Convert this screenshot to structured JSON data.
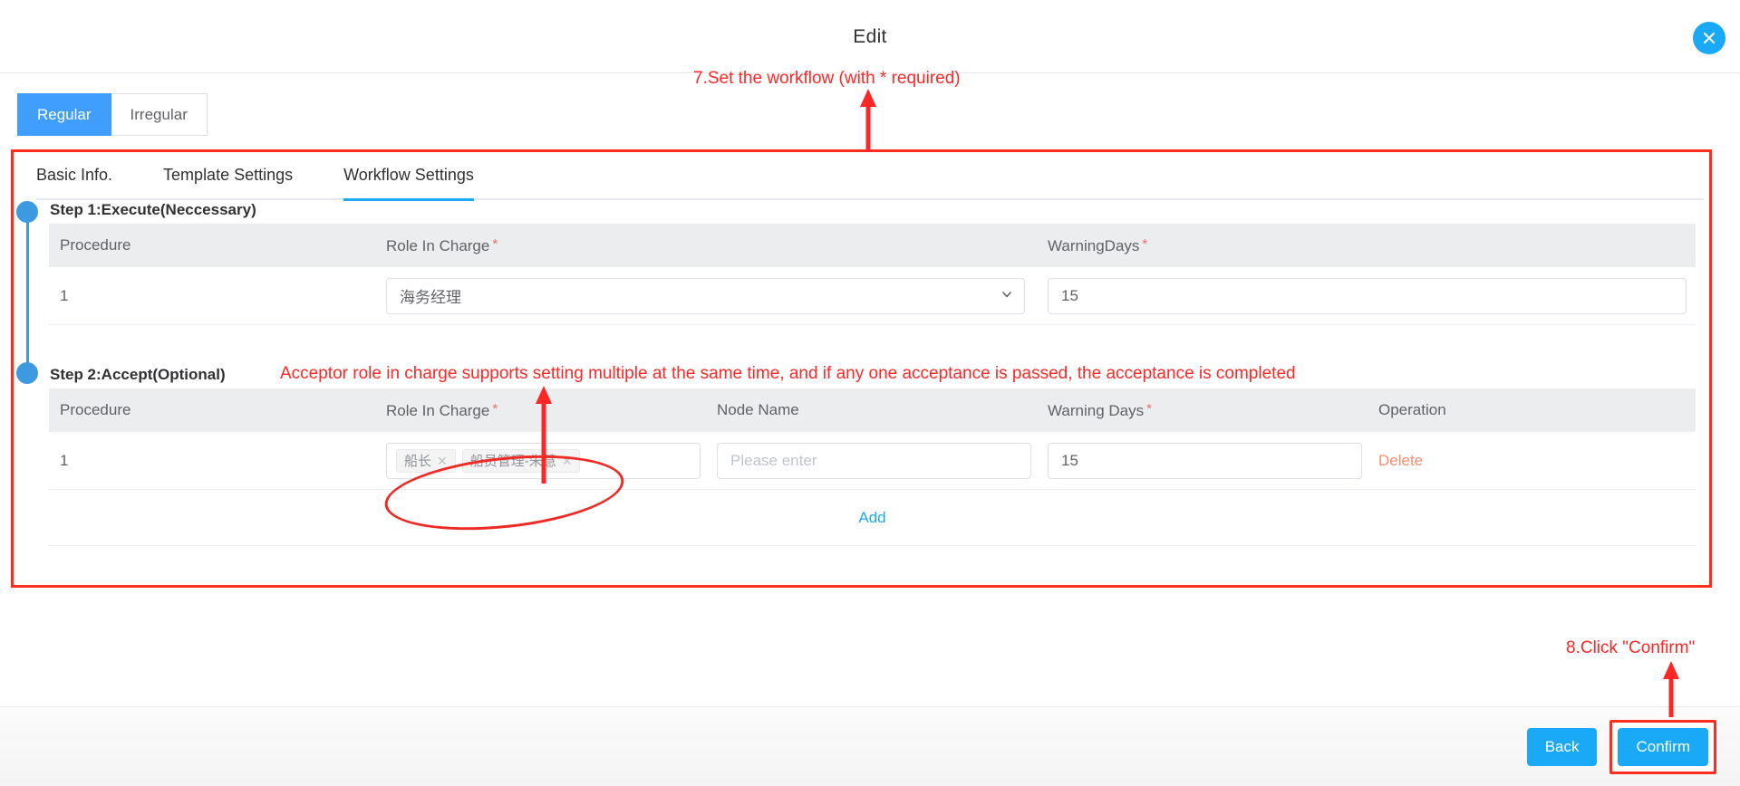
{
  "dialog": {
    "title": "Edit",
    "close_icon": "close-circle-icon"
  },
  "segmented_tabs": [
    {
      "label": "Regular",
      "active": true
    },
    {
      "label": "Irregular",
      "active": false
    }
  ],
  "panel_tabs": [
    {
      "label": "Basic Info.",
      "active": false
    },
    {
      "label": "Template Settings",
      "active": false
    },
    {
      "label": "Workflow Settings",
      "active": true
    }
  ],
  "step1": {
    "label": "Step 1:Execute(Neccessary)",
    "columns": {
      "procedure": "Procedure",
      "role_in_charge": "Role In Charge",
      "warning_days": "WarningDays"
    },
    "row": {
      "procedure": "1",
      "role_in_charge": "海务经理",
      "warning_days": "15"
    }
  },
  "step2": {
    "label": "Step 2:Accept(Optional)",
    "columns": {
      "procedure": "Procedure",
      "role_in_charge": "Role In Charge",
      "node_name": "Node Name",
      "warning_days": "Warning Days",
      "operation": "Operation"
    },
    "row": {
      "procedure": "1",
      "role_tags": [
        "船长",
        "船员管理-朱慧"
      ],
      "node_name_placeholder": "Please enter",
      "node_name_value": "",
      "warning_days": "15",
      "delete_label": "Delete"
    },
    "add_label": "Add"
  },
  "footer": {
    "back_label": "Back",
    "confirm_label": "Confirm"
  },
  "annotations": {
    "a1": "7.Set the workflow (with * required)",
    "a2": "Acceptor role in charge supports setting multiple at the same time, and if any one acceptance is passed, the acceptance is completed",
    "a3": "8.Click \"Confirm\""
  },
  "colors": {
    "accent": "#19a9f7",
    "primary_blue": "#409eff",
    "annotation_red": "#ff2626",
    "required_star": "#f56c6c",
    "delete_orange": "#f78d71",
    "rail_blue": "#3d9ae0"
  }
}
